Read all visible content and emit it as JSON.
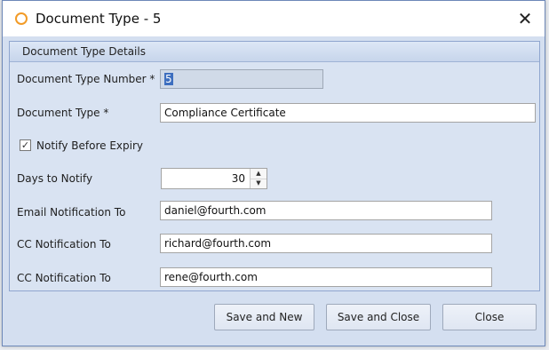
{
  "window": {
    "title": "Document Type - 5",
    "close_glyph": "✕"
  },
  "group": {
    "title": "Document Type Details"
  },
  "fields": {
    "number_label": "Document Type Number *",
    "number_value": "5",
    "type_label": "Document Type *",
    "type_value": "Compliance Certificate",
    "notify_label": "Notify Before Expiry",
    "notify_checked": true,
    "days_label": "Days to Notify",
    "days_value": "30",
    "email_label": "Email Notification To",
    "email_value": "daniel@fourth.com",
    "cc1_label": "CC Notification To",
    "cc1_value": "richard@fourth.com",
    "cc2_label": "CC Notification To",
    "cc2_value": "rene@fourth.com"
  },
  "icons": {
    "check": "✓",
    "spin_up": "▲",
    "spin_down": "▼"
  },
  "buttons": {
    "save_new": "Save and New",
    "save_close": "Save and Close",
    "close": "Close"
  },
  "colors": {
    "accent": "#f29b27",
    "selection": "#3e6fbf",
    "panel": "#d9e3f2"
  }
}
